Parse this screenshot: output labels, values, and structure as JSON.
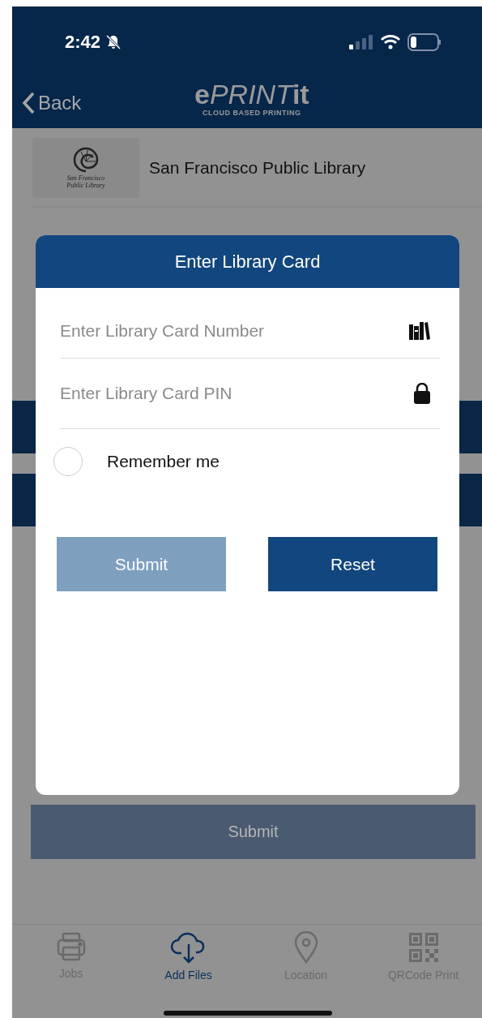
{
  "status_bar": {
    "time": "2:42",
    "silent": true
  },
  "nav": {
    "back": "Back",
    "logo": [
      "e",
      "PRINT",
      "it"
    ],
    "tagline": "CLOUD BASED PRINTING"
  },
  "library": {
    "logo_caption": "San Francisco Public Library",
    "name": "San Francisco Public Library"
  },
  "submit_button": {
    "label": "Submit",
    "disabled": true
  },
  "dialog": {
    "title": "Enter Library Card",
    "fields": [
      {
        "placeholder": "Enter Library Card Number",
        "kind": "card"
      },
      {
        "placeholder": "Enter Library Card PIN",
        "kind": "pin"
      }
    ],
    "remember": {
      "label": "Remember me",
      "checked": false
    },
    "buttons": [
      {
        "label": "Submit",
        "disabled": true
      },
      {
        "label": "Reset",
        "disabled": false
      }
    ]
  },
  "tabs": [
    {
      "label": "Jobs",
      "kind": "printer",
      "selected": false
    },
    {
      "label": "Add Files",
      "kind": "cloud",
      "selected": true
    },
    {
      "label": "Location",
      "kind": "pin",
      "selected": false
    },
    {
      "label": "QRCode Print",
      "kind": "qr",
      "selected": false
    }
  ]
}
